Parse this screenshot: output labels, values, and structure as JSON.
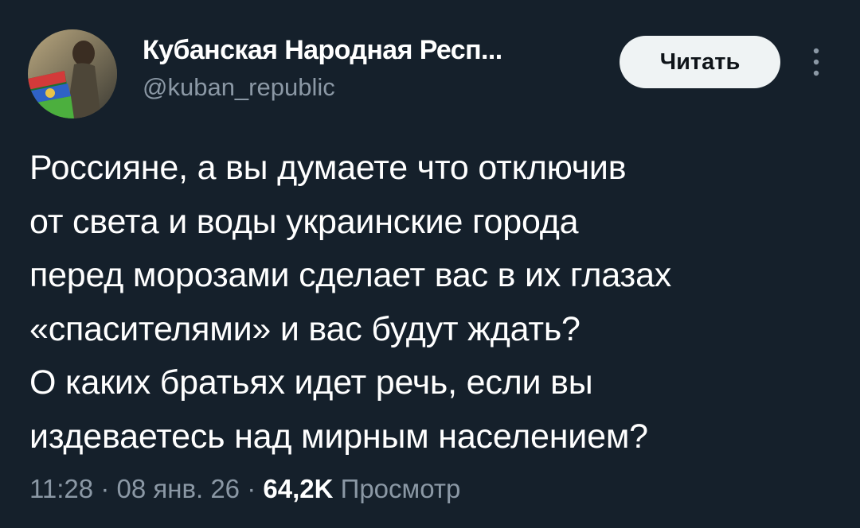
{
  "author": {
    "display_name": "Кубанская Народная Респ...",
    "handle": "@kuban_republic"
  },
  "follow_button": {
    "label": "Читать"
  },
  "more_button": {
    "icon": "more-vertical-icon"
  },
  "tweet": {
    "lines": [
      "Россияне, а вы думаете что отключив",
      "от света и воды украинские города",
      "перед морозами сделает вас в их глазах",
      "«спасителями» и вас будут ждать?",
      "О каких братьях идет речь, если вы",
      "издеваетесь над мирным населением?"
    ]
  },
  "meta": {
    "time": "11:28",
    "separator": "·",
    "date": "08 янв. 26",
    "views_count": "64,2K",
    "views_label": "Просмотр"
  },
  "colors": {
    "background": "#15202b",
    "secondary_text": "#8b98a5",
    "button_bg": "#eff3f4"
  }
}
